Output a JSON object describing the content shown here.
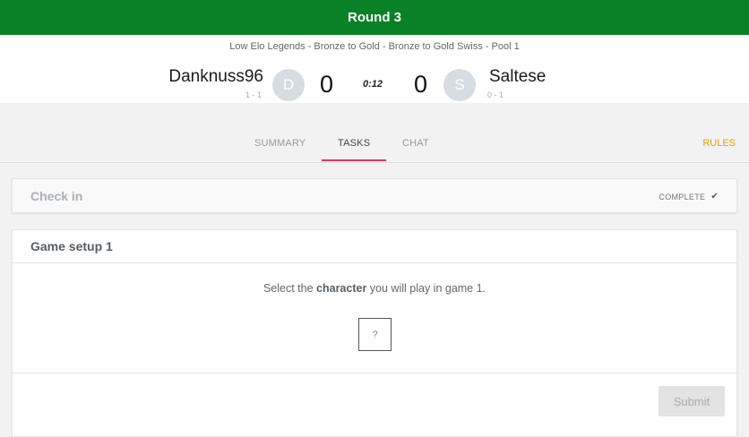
{
  "topbar": {
    "title": "Round 3"
  },
  "match": {
    "event_name": "Low Elo Legends - Bronze to Gold - Bronze to Gold Swiss - Pool 1",
    "player1": {
      "name": "Danknuss96",
      "record": "1 - 1",
      "avatar_letter": "D",
      "score": "0"
    },
    "player2": {
      "name": "Saltese",
      "record": "0 - 1",
      "avatar_letter": "S",
      "score": "0"
    },
    "timer": "0:12"
  },
  "tabs": [
    {
      "label": "SUMMARY",
      "active": false
    },
    {
      "label": "TASKS",
      "active": true
    },
    {
      "label": "CHAT",
      "active": false
    }
  ],
  "rules_label": "RULES",
  "checkin": {
    "title": "Check in",
    "status": "COMPLETE",
    "status_icon": "checkmark-icon"
  },
  "game_setup": {
    "title": "Game setup 1",
    "instruction_pre": "Select the ",
    "instruction_bold": "character",
    "instruction_post": " you will play in game 1.",
    "picker_placeholder": "?",
    "submit_label": "Submit"
  },
  "colors": {
    "topbar": "#0a8127",
    "tab_accent": "#e8336d",
    "rules": "#e8a200"
  }
}
